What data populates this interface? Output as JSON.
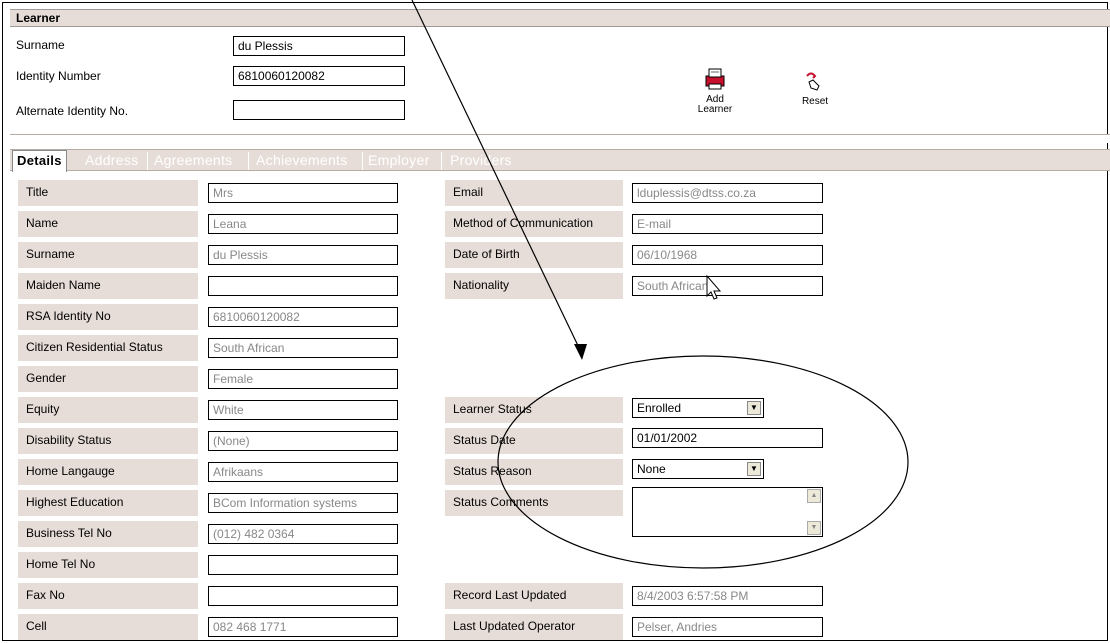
{
  "learner": {
    "title": "Learner",
    "surname_label": "Surname",
    "surname_value": "du Plessis",
    "idnum_label": "Identity Number",
    "idnum_value": "6810060120082",
    "altid_label": "Alternate Identity No.",
    "altid_value": ""
  },
  "toolbar": {
    "add_label_1": "Add",
    "add_label_2": "Learner",
    "reset_label": "Reset"
  },
  "tabs": [
    "Details",
    "Address",
    "Agreements",
    "Achievements",
    "Employer",
    "Providers"
  ],
  "details_left": [
    {
      "label": "Title",
      "value": "Mrs"
    },
    {
      "label": "Name",
      "value": "Leana"
    },
    {
      "label": "Surname",
      "value": "du Plessis"
    },
    {
      "label": "Maiden Name",
      "value": ""
    },
    {
      "label": "RSA Identity No",
      "value": "6810060120082"
    },
    {
      "label": "Citizen Residential Status",
      "value": "South African"
    },
    {
      "label": "Gender",
      "value": "Female"
    },
    {
      "label": "Equity",
      "value": "White"
    },
    {
      "label": "Disability Status",
      "value": "(None)"
    },
    {
      "label": "Home Langauge",
      "value": "Afrikaans"
    },
    {
      "label": "Highest Education",
      "value": "BCom Information systems"
    },
    {
      "label": "Business Tel No",
      "value": "(012) 482 0364"
    },
    {
      "label": "Home Tel No",
      "value": ""
    },
    {
      "label": "Fax No",
      "value": ""
    },
    {
      "label": "Cell",
      "value": "082 468 1771"
    }
  ],
  "details_right": {
    "email_label": "Email",
    "email_value": "lduplessis@dtss.co.za",
    "moc_label": "Method of Communication",
    "moc_value": "E-mail",
    "dob_label": "Date of Birth",
    "dob_value": "06/10/1968",
    "nationality_label": "Nationality",
    "nationality_value": "South African",
    "learner_status_label": "Learner Status",
    "learner_status_value": "Enrolled",
    "status_date_label": "Status Date",
    "status_date_value": "01/01/2002",
    "status_reason_label": "Status Reason",
    "status_reason_value": "None",
    "status_comments_label": "Status Comments",
    "status_comments_value": "",
    "record_updated_label": "Record Last Updated",
    "record_updated_value": "8/4/2003 6:57:58 PM",
    "last_operator_label": "Last Updated Operator",
    "last_operator_value": "Pelser, Andries"
  },
  "icons": {
    "add": "printer-add-icon",
    "reset": "hand-reset-icon",
    "cursor": "mouse-pointer-icon"
  },
  "colors": {
    "label_bg": "#e7ddd8",
    "tab_text": "#ffffff"
  }
}
